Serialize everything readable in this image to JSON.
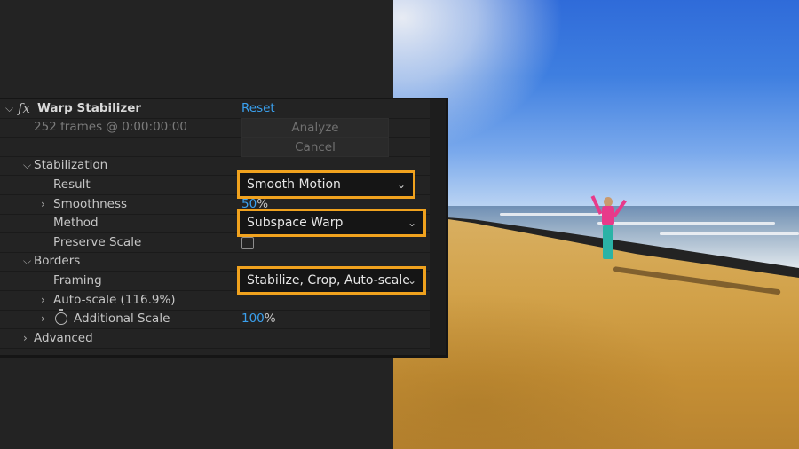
{
  "effect": {
    "name": "Warp Stabilizer",
    "fx_glyph": "fx",
    "reset_label": "Reset",
    "status": "252 frames @ 0:00:00:00",
    "analyze_label": "Analyze",
    "cancel_label": "Cancel"
  },
  "stabilization": {
    "label": "Stabilization",
    "result_label": "Result",
    "result_value": "Smooth Motion",
    "smoothness_label": "Smoothness",
    "smoothness_value": "50",
    "smoothness_unit": "%",
    "method_label": "Method",
    "method_value": "Subspace Warp",
    "preserve_scale_label": "Preserve Scale",
    "preserve_scale_checked": false
  },
  "borders": {
    "label": "Borders",
    "framing_label": "Framing",
    "framing_value": "Stabilize, Crop, Auto-scale",
    "autoscale_label": "Auto-scale (116.9%)",
    "additional_scale_label": "Additional Scale",
    "additional_scale_value": "100",
    "additional_scale_unit": "%"
  },
  "advanced": {
    "label": "Advanced"
  },
  "colors": {
    "panel_bg": "#232323",
    "highlight": "#f0a21e",
    "value_blue": "#3aa0ee"
  }
}
